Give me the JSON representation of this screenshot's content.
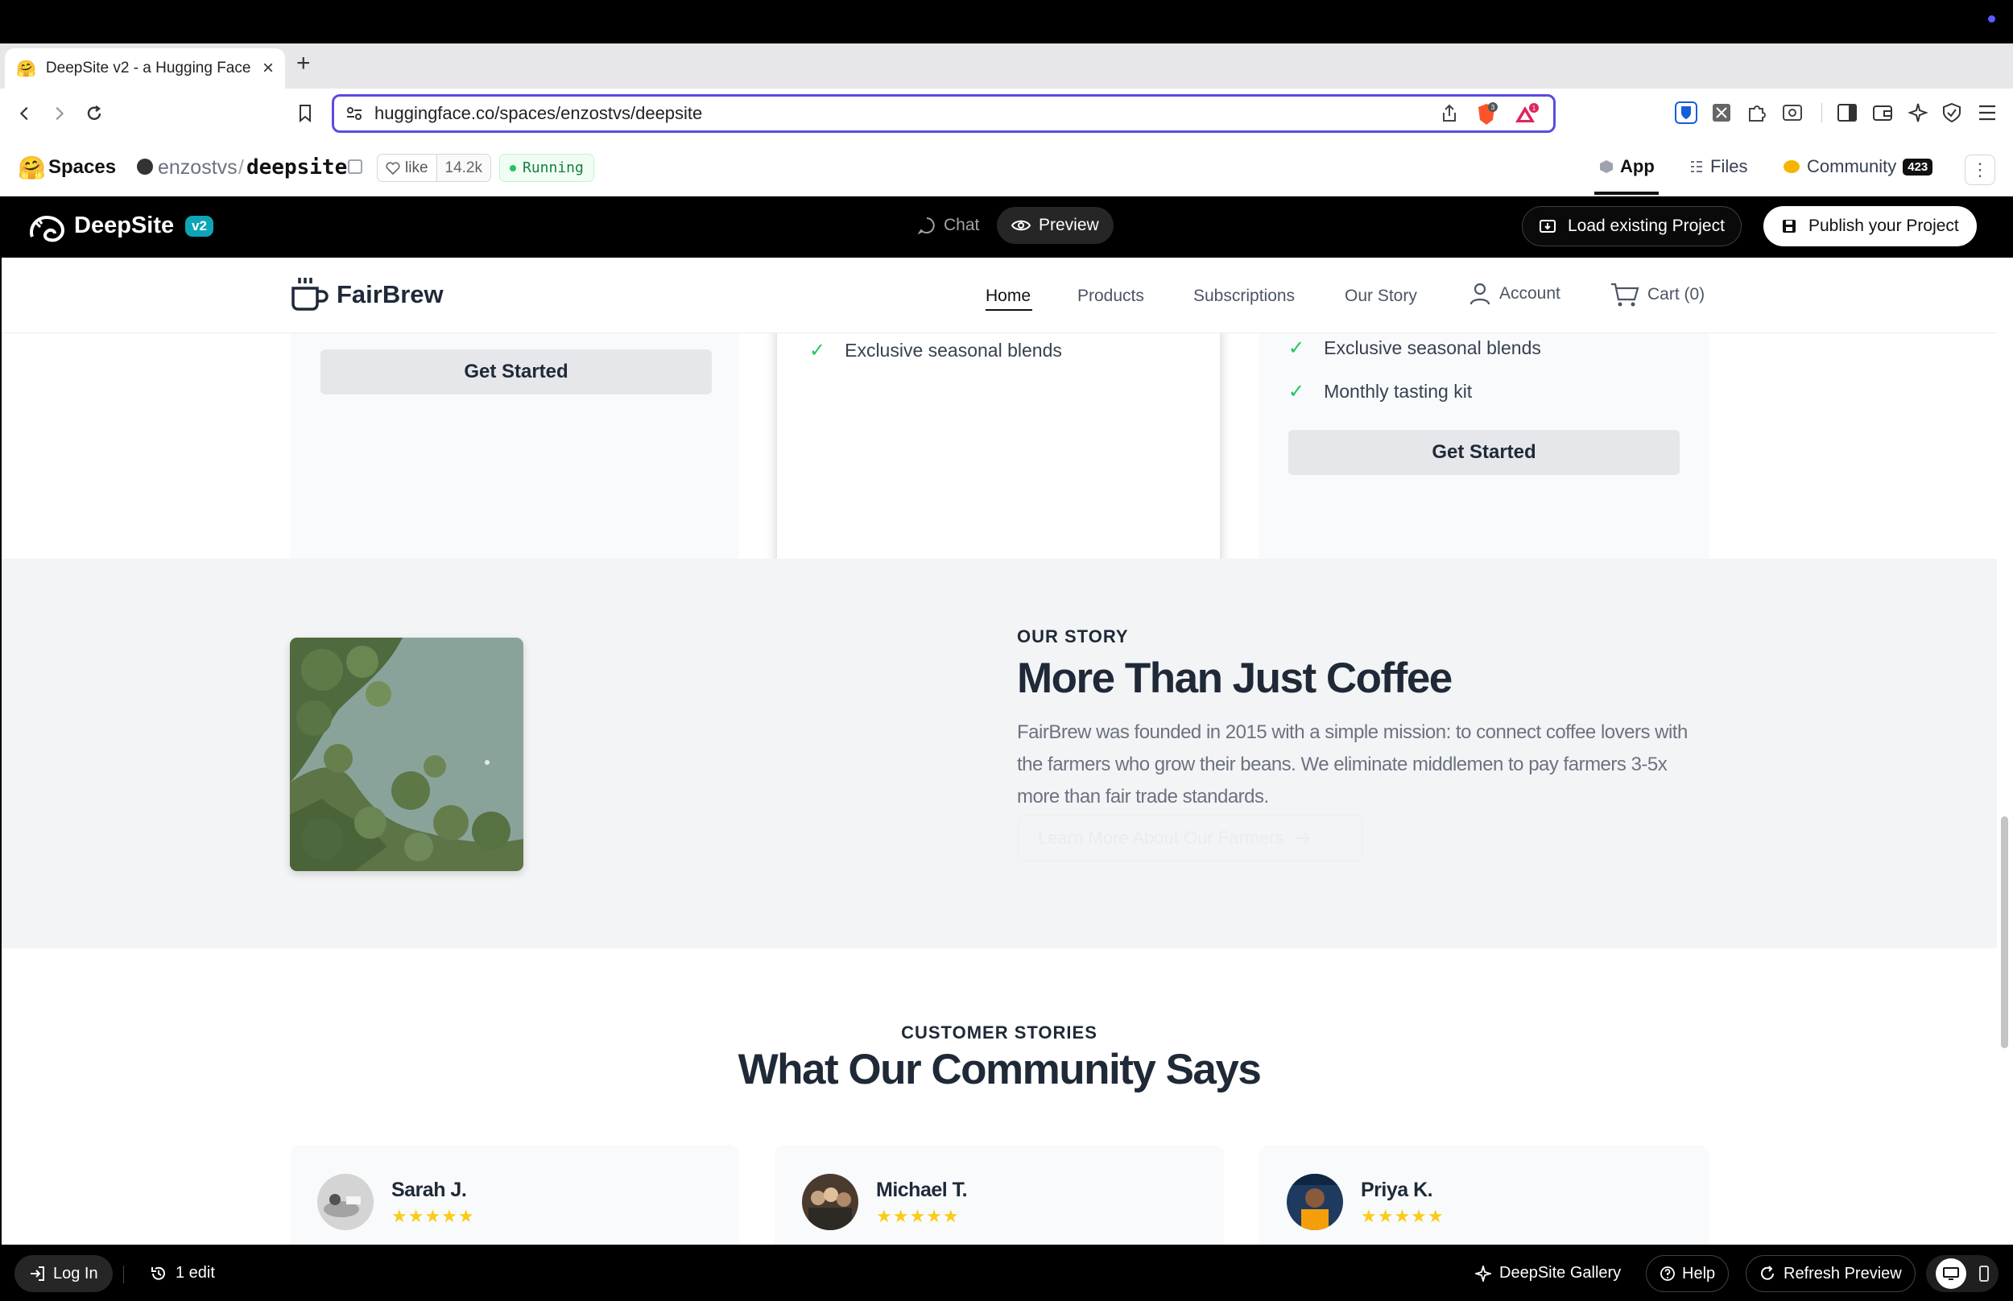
{
  "browser": {
    "tab_title": "DeepSite v2 - a Hugging Face",
    "new_tab": "+",
    "url": "huggingface.co/spaces/enzostvs/deepsite",
    "brave_count": "3",
    "rewards_count": "1"
  },
  "hf": {
    "spaces_label": "Spaces",
    "owner": "enzostvs",
    "slash": "/",
    "repo": "deepsite",
    "like_label": "like",
    "like_count": "14.2k",
    "status": "Running",
    "tabs": {
      "app": "App",
      "files": "Files",
      "community": "Community",
      "community_count": "423"
    }
  },
  "deepsite": {
    "name": "DeepSite",
    "version_badge": "v2",
    "chat_label": "Chat",
    "preview_label": "Preview",
    "load_label": "Load existing Project",
    "publish_label": "Publish your Project"
  },
  "site": {
    "brand": "FairBrew",
    "nav": {
      "home": "Home",
      "products": "Products",
      "subscriptions": "Subscriptions",
      "our_story": "Our Story",
      "account": "Account",
      "cart": "Cart (0)"
    },
    "pricing": {
      "card1_button": "Get Started",
      "card2_feature": "Exclusive seasonal blends",
      "card3_feature_top": "Exclusive seasonal blends",
      "card3_feature": "Monthly tasting kit",
      "card3_button": "Get Started"
    },
    "story": {
      "kicker": "OUR STORY",
      "title": "More Than Just Coffee",
      "body": "FairBrew was founded in 2015 with a simple mission: to connect coffee lovers with the farmers who grow their beans. We eliminate middlemen to pay farmers 3-5x more than fair trade standards.",
      "cta": "Learn More About Our Farmers"
    },
    "testimonials": {
      "kicker": "CUSTOMER STORIES",
      "title": "What Our Community Says",
      "people": [
        {
          "name": "Sarah J.",
          "stars": "★★★★★",
          "rating": 5
        },
        {
          "name": "Michael T.",
          "stars": "★★★★★",
          "rating": 5
        },
        {
          "name": "Priya K.",
          "stars": "★★★★★",
          "rating": 5
        }
      ]
    }
  },
  "bottom": {
    "login": "Log In",
    "edits": "1 edit",
    "gallery": "DeepSite Gallery",
    "help": "Help",
    "refresh": "Refresh Preview"
  },
  "colors": {
    "accent_url_border": "#5b4be0",
    "deepsite_badge": "#0ea5b7",
    "check_green": "#22c55e",
    "star_yellow": "#facc15",
    "running_green": "#15803d"
  },
  "icons": [
    "back-icon",
    "forward-icon",
    "reload-icon",
    "bookmark-icon",
    "site-settings-icon",
    "share-icon",
    "brave-shield-icon",
    "brave-rewards-icon",
    "bitwarden-icon",
    "extension-icon",
    "puzzle-icon",
    "sidebar-icon",
    "wallet-icon",
    "leo-icon",
    "vpn-icon",
    "menu-icon",
    "heart-icon",
    "copy-icon",
    "cube-icon",
    "files-icon",
    "community-icon",
    "chat-icon",
    "eye-icon",
    "folder-icon",
    "save-icon",
    "coffee-cup-icon",
    "user-icon",
    "cart-icon",
    "check-icon",
    "arrow-right-icon",
    "login-icon",
    "history-icon",
    "sparkle-icon",
    "help-icon",
    "refresh-icon",
    "desktop-icon",
    "mobile-icon"
  ]
}
